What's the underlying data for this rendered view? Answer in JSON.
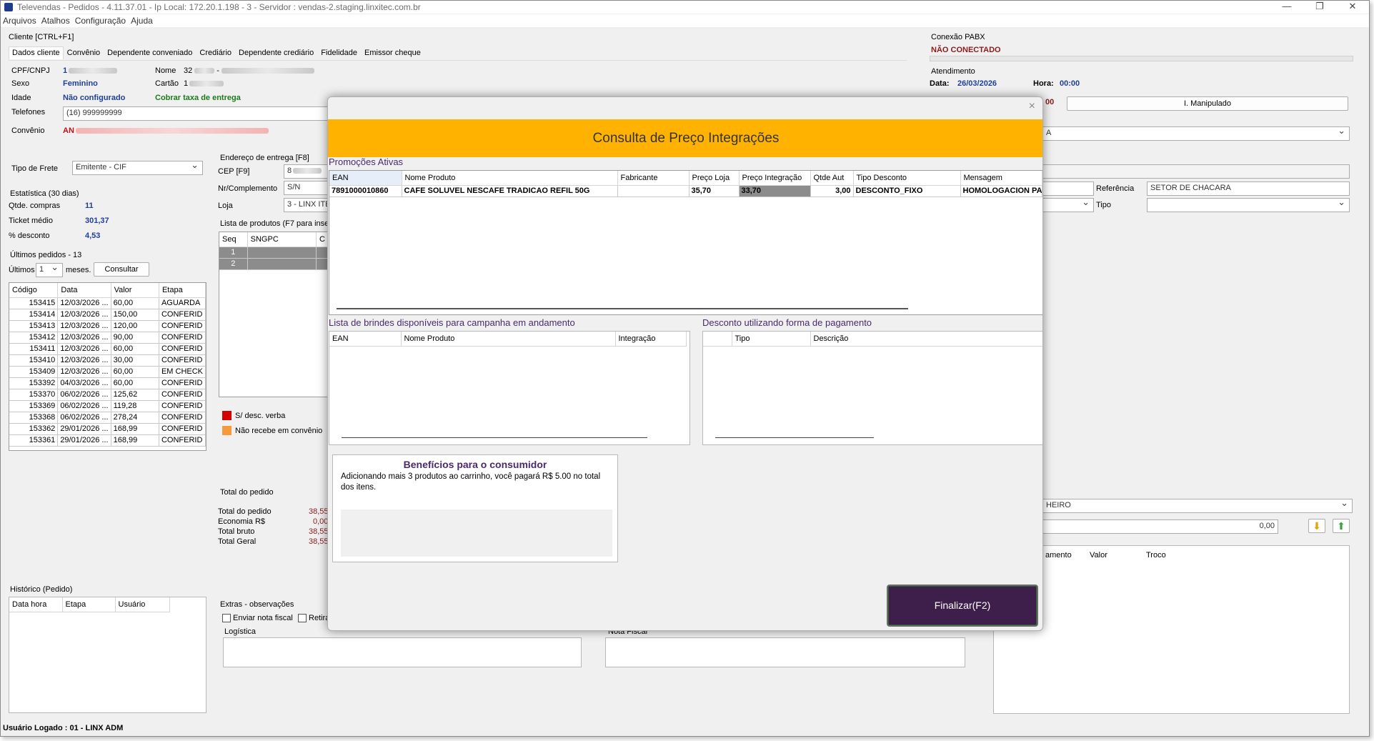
{
  "window": {
    "title": "Televendas - Pedidos - 4.11.37.01 - Ip Local: 172.20.1.198 - 3 - Servidor : vendas-2.staging.linxitec.com.br",
    "controls": [
      "—",
      "❐",
      "✕"
    ]
  },
  "menu": [
    "Arquivos",
    "Atalhos",
    "Configuração",
    "Ajuda"
  ],
  "cliente": {
    "group_label": "Cliente [CTRL+F1]",
    "tabs": [
      "Dados cliente",
      "Convênio",
      "Dependente conveniado",
      "Crediário",
      "Dependente crediário",
      "Fidelidade",
      "Emissor cheque"
    ],
    "cpf_label": "CPF/CNPJ",
    "cpf_value": "1",
    "nome_label": "Nome",
    "nome_value": "32",
    "nome_sep": "-",
    "sexo_label": "Sexo",
    "sexo_value": "Feminino",
    "cartao_label": "Cartão",
    "cartao_value": "1",
    "idade_label": "Idade",
    "idade_value": "Não configurado",
    "taxa_label": "Cobrar taxa de entrega",
    "telefones_label": "Telefones",
    "telefones_value": "(16) 999999999",
    "convenio_label": "Convênio",
    "convenio_value": "AN"
  },
  "pabx": {
    "label": "Conexão PABX",
    "status": "NÃO CONECTADO"
  },
  "atendimento": {
    "label": "Atendimento",
    "data_label": "Data:",
    "data_value": "26/03/2026",
    "hora_label": "Hora:",
    "hora_value": "00:00",
    "partial_red": "00",
    "manipulado_button": "I. Manipulado",
    "combo_partial": "A"
  },
  "frete": {
    "label": "Tipo de Frete",
    "value": "Emitente - CIF"
  },
  "estatistica": {
    "label": "Estatística (30 dias)",
    "compras_label": "Qtde. compras",
    "compras_value": "11",
    "ticket_label": "Ticket médio",
    "ticket_value": "301,37",
    "desconto_label": "% desconto",
    "desconto_value": "4,53"
  },
  "ultimos": {
    "label": "Últimos pedidos - 13",
    "ultimos_label": "Últimos",
    "ultimos_value": "1",
    "meses_label": "meses.",
    "consultar_button": "Consultar",
    "columns": [
      "Código",
      "Data",
      "Valor",
      "Etapa"
    ],
    "rows": [
      [
        "153415",
        "12/03/2026 ...",
        "60,00",
        "AGUARDA"
      ],
      [
        "153414",
        "12/03/2026 ...",
        "150,00",
        "CONFERID"
      ],
      [
        "153413",
        "12/03/2026 ...",
        "120,00",
        "CONFERID"
      ],
      [
        "153412",
        "12/03/2026 ...",
        "90,00",
        "CONFERID"
      ],
      [
        "153411",
        "12/03/2026 ...",
        "60,00",
        "CONFERID"
      ],
      [
        "153410",
        "12/03/2026 ...",
        "30,00",
        "CONFERID"
      ],
      [
        "153409",
        "12/03/2026 ...",
        "60,00",
        "EM CHECK"
      ],
      [
        "153392",
        "04/03/2026 ...",
        "60,00",
        "CONFERID"
      ],
      [
        "153370",
        "06/02/2026 ...",
        "125,62",
        "CONFERID"
      ],
      [
        "153369",
        "06/02/2026 ...",
        "119,28",
        "CONFERID"
      ],
      [
        "153368",
        "06/02/2026 ...",
        "278,24",
        "CONFERID"
      ],
      [
        "153362",
        "29/01/2026 ...",
        "168,99",
        "CONFERID"
      ],
      [
        "153361",
        "29/01/2026 ...",
        "168,99",
        "CONFERID"
      ]
    ]
  },
  "historico": {
    "label": "Histórico (Pedido)",
    "columns": [
      "Data hora",
      "Etapa",
      "Usuário"
    ]
  },
  "entrega": {
    "label": "Endereço de entrega [F8]",
    "cep_label": "CEP [F9]",
    "cep_value": "8",
    "nr_label": "Nr/Complemento",
    "nr_value": "S/N",
    "loja_label": "Loja",
    "loja_value": "3 - LINX ITE",
    "referencia_label": "Referência",
    "referencia_value": "SETOR DE CHACARA",
    "tipo_label": "Tipo"
  },
  "produtos": {
    "label": "Lista de produtos (F7 para inser",
    "columns": [
      "Seq",
      "SNGPC",
      "C"
    ],
    "rows": [
      [
        "1"
      ],
      [
        "2"
      ]
    ]
  },
  "legenda": {
    "verba": "S/ desc. verba",
    "verba_color": "#d40000",
    "convenio": "Não recebe em convênio",
    "convenio_color": "#f79a3c"
  },
  "totais": {
    "label": "Total do pedido",
    "rows": [
      {
        "label": "Total do pedido",
        "value": "38,55"
      },
      {
        "label": "Economia R$",
        "value": "0,00"
      },
      {
        "label": "Total bruto",
        "value": "38,55"
      },
      {
        "label": "Total Geral",
        "value": "38,55"
      }
    ]
  },
  "extras": {
    "label": "Extras - observações",
    "nota_fiscal_label": "Enviar nota fiscal",
    "retira_label": "Retira",
    "logistica_label": "Logística",
    "nota_label": "Nota Fiscal"
  },
  "pagamento": {
    "forma_value": "HEIRO",
    "valor_value": "0,00",
    "columns": [
      "amento",
      "Valor",
      "Troco"
    ]
  },
  "status": {
    "usuario": "Usuário Logado : 01 - LINX ADM"
  },
  "modal": {
    "close_icon": "×",
    "title": "Consulta de Preço Integrações",
    "promocoes_label": "Promoções Ativas",
    "promo_columns": [
      "EAN",
      "Nome Produto",
      "Fabricante",
      "Preço Loja",
      "Preço Integração",
      "Qtde Aut",
      "Tipo Desconto",
      "Mensagem"
    ],
    "promo_rows": [
      [
        "7891000010860",
        "CAFE SOLUVEL NESCAFE TRADICAO REFIL 50G",
        "",
        "35,70",
        "33,70",
        "3,00",
        "DESCONTO_FIXO",
        "HOMOLOGACION PAC"
      ]
    ],
    "brindes_label": "Lista de brindes disponíveis para campanha em andamento",
    "brindes_columns": [
      "EAN",
      "Nome Produto",
      "Integração"
    ],
    "desconto_label": "Desconto utilizando forma de pagamento",
    "desconto_columns": [
      "",
      "Tipo",
      "Descrição"
    ],
    "beneficios_title": "Benefícios para o consumidor",
    "beneficios_text": "Adicionando mais 3 produtos ao carrinho, você pagará R$ 5.00 no total dos itens.",
    "finalizar_button": "Finalizar(F2)",
    "banner_color": "#ffb300",
    "finalizar_color": "#3e1f4c"
  }
}
